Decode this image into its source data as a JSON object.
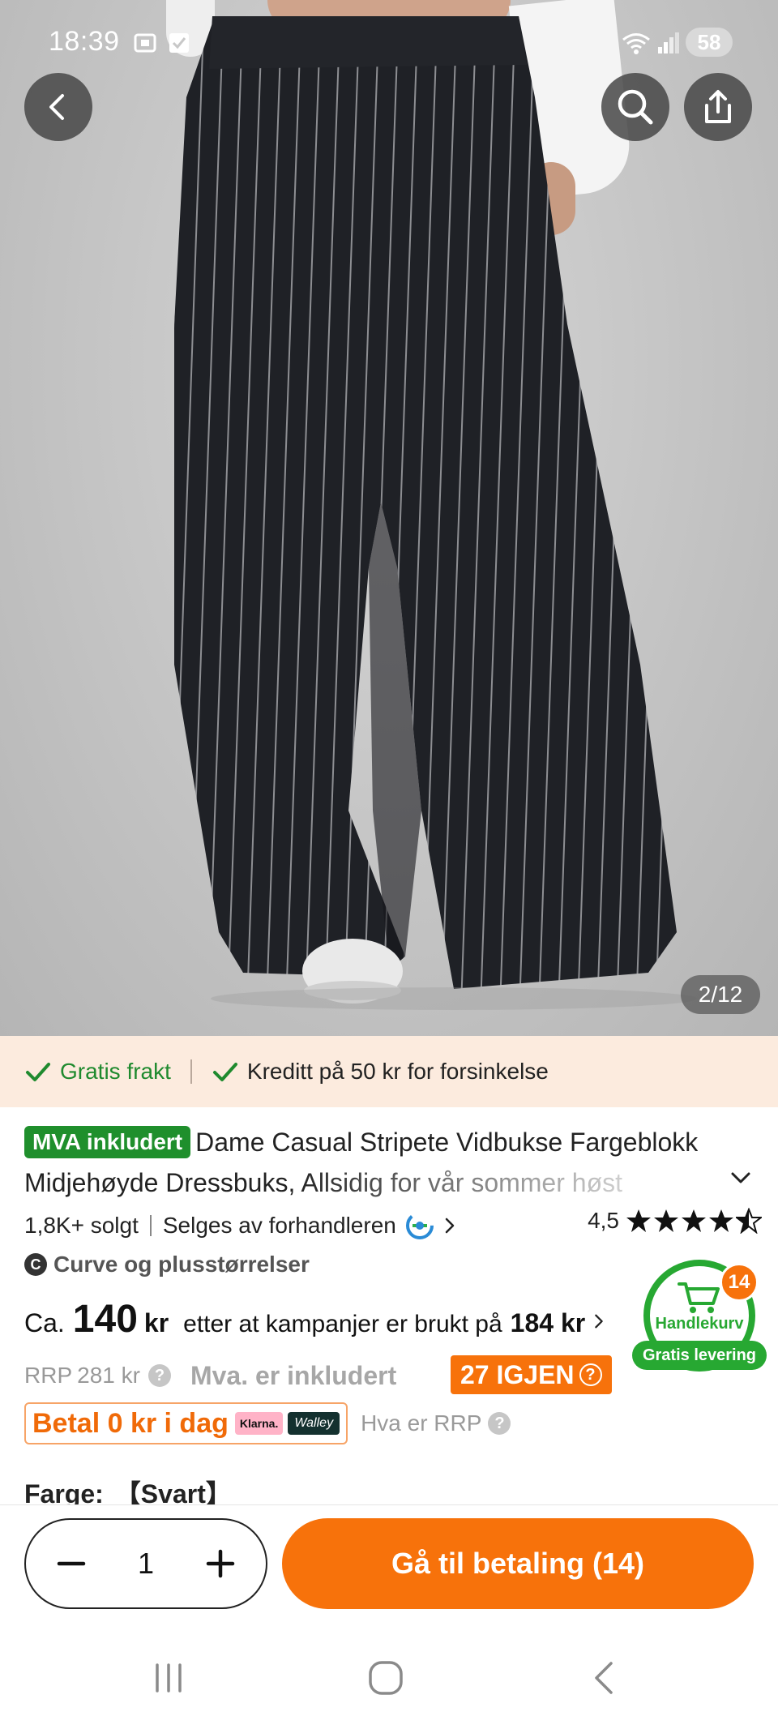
{
  "status_bar": {
    "time": "18:39",
    "battery": "58"
  },
  "gallery": {
    "pager": "2/12"
  },
  "shipping_banner": {
    "free_shipping": "Gratis frakt",
    "delay_credit": "Kreditt på 50 kr for forsinkelse"
  },
  "product": {
    "vat_badge": "MVA inkludert",
    "title": "Dame Casual Stripete Vidbukse Fargeblokk Midjehøyde Dressbuks, Allsidig for vår sommer høst",
    "sold": "1,8K+ solgt",
    "seller": "Selges av forhandleren",
    "rating": "4,5",
    "rating_value": 4.5,
    "rating_max": 5,
    "curve_badge": "C",
    "curve": "Curve og plusstørrelser"
  },
  "price": {
    "ca": "Ca.",
    "value": "140",
    "currency": "kr",
    "after_text": "etter at kampanjer er brukt på",
    "after_value": "184 kr",
    "rrp_label": "RRP",
    "rrp_value": "281 kr",
    "vat_text": "Mva. er inkludert",
    "left_badge": "27 IGJEN",
    "pay_today": "Betal 0 kr i dag",
    "klarna": "Klarna.",
    "walley": "Walley",
    "rrp_question": "Hva er RRP"
  },
  "cart_float": {
    "count": "14",
    "label": "Handlekurv",
    "ribbon": "Gratis levering"
  },
  "color": {
    "label": "Farge:",
    "value": "【Svart】"
  },
  "bottom_bar": {
    "quantity": "1",
    "checkout": "Gå til betaling (14)"
  },
  "colors": {
    "accent": "#f7720b",
    "green": "#1f8f2c",
    "banner_bg": "#fcebde"
  },
  "icons": [
    "back-icon",
    "search-icon",
    "share-icon",
    "check-icon",
    "chevron-down-icon",
    "chevron-right-icon",
    "star-icon",
    "cart-icon",
    "minus-icon",
    "plus-icon",
    "recents-icon",
    "home-icon",
    "nav-back-icon"
  ]
}
